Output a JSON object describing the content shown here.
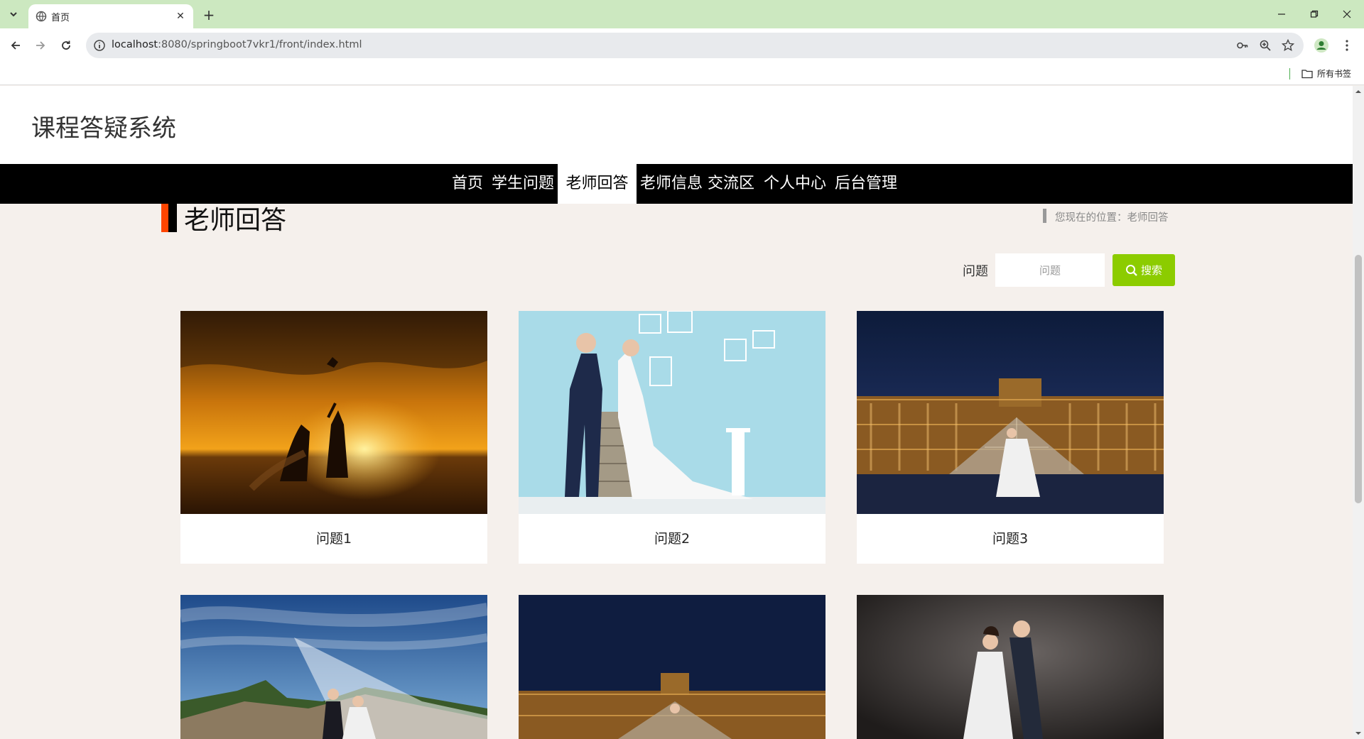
{
  "browser": {
    "tab_title": "首页",
    "url_host": "localhost",
    "url_rest": ":8080/springboot7vkr1/front/index.html",
    "bookmarks_all": "所有书签"
  },
  "site": {
    "title": "课程答疑系统"
  },
  "nav": {
    "items": [
      {
        "label": "首页"
      },
      {
        "label": "学生问题"
      },
      {
        "label": "老师回答"
      },
      {
        "label": "老师信息"
      },
      {
        "label": "交流区"
      },
      {
        "label": "个人中心"
      },
      {
        "label": "后台管理"
      }
    ],
    "active_index": 2
  },
  "section": {
    "title": "老师回答",
    "breadcrumb": "您现在的位置：老师回答"
  },
  "search": {
    "label": "问题",
    "placeholder": "问题",
    "button": "搜索"
  },
  "cards": [
    {
      "caption": "问题1"
    },
    {
      "caption": "问题2"
    },
    {
      "caption": "问题3"
    },
    {
      "caption": ""
    },
    {
      "caption": ""
    },
    {
      "caption": ""
    }
  ],
  "colors": {
    "accent_green": "#8ccc00",
    "accent_orange": "#ff4500",
    "nav_bg": "#000000",
    "tabbar_bg": "#cce8c0"
  }
}
